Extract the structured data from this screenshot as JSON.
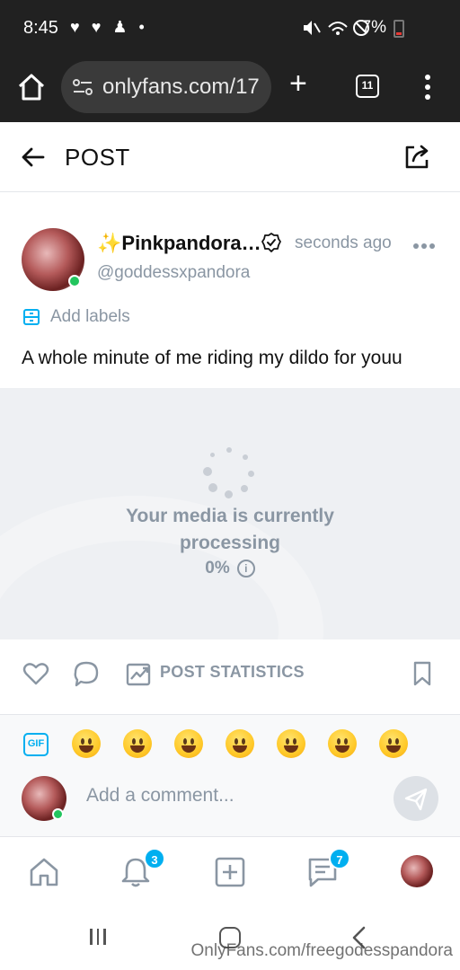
{
  "status_bar": {
    "time": "8:45",
    "battery": "7%"
  },
  "browser": {
    "url": "onlyfans.com/17",
    "tab_count": "11"
  },
  "header": {
    "title": "POST"
  },
  "post": {
    "display_name": "✨Pinkpandora…",
    "time_ago": "seconds ago",
    "handle": "@goddessxpandora",
    "add_labels": "Add labels",
    "text": "A whole minute of me riding my dildo for youu"
  },
  "media": {
    "processing_line1": "Your media is currently",
    "processing_line2": "processing",
    "progress_percent": "0%"
  },
  "actions": {
    "stats_label": "POST STATISTICS"
  },
  "emoji_bar": {
    "gif_label": "GIF",
    "emojis": [
      "grinning-face",
      "beaming-face",
      "tears-of-joy-face",
      "grinning-big-eyes-face",
      "smiling-eyes-face",
      "sweat-smile-face",
      "squinting-face"
    ]
  },
  "comment": {
    "placeholder": "Add a comment..."
  },
  "bottom_nav": {
    "notifications_badge": "3",
    "messages_badge": "7"
  },
  "watermark": "OnlyFans.com/freegodesspandora",
  "colors": {
    "accent": "#00aff0",
    "muted": "#8a96a3",
    "online": "#22c55e",
    "dark_bar": "#212121"
  }
}
